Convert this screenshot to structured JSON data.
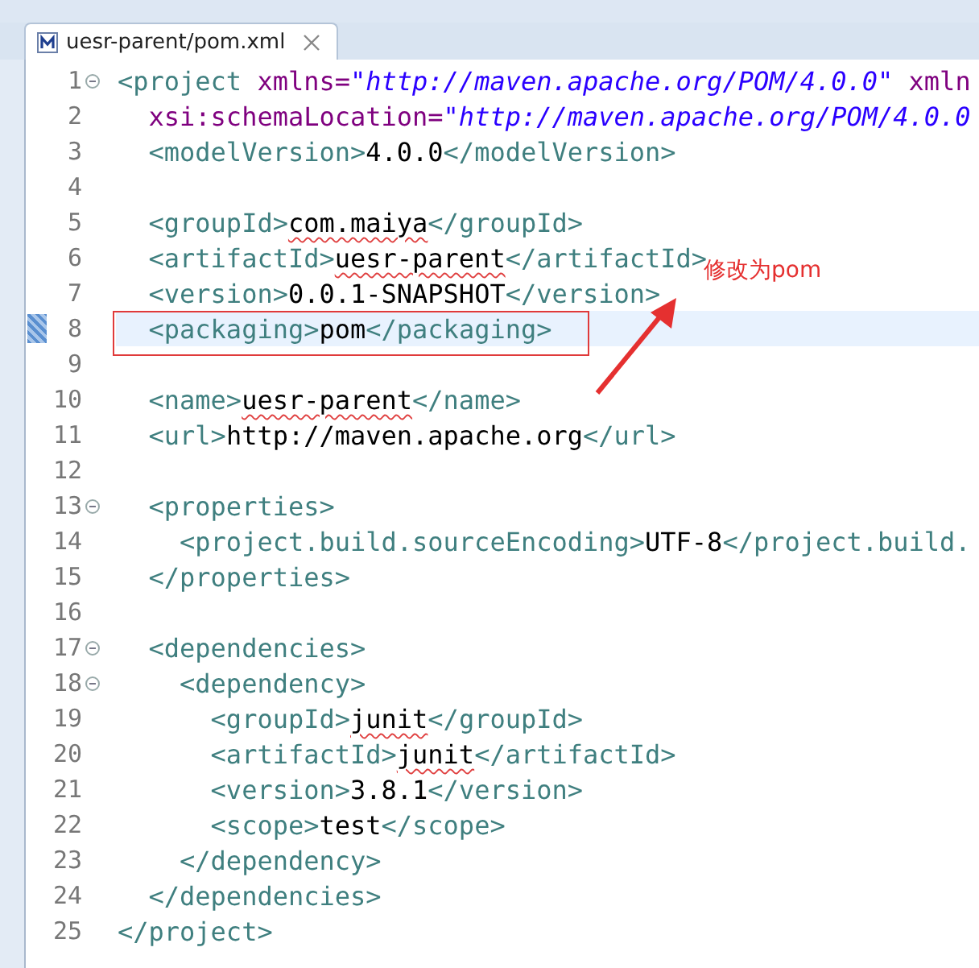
{
  "tab": {
    "title": "uesr-parent/pom.xml",
    "selected": true
  },
  "lines": [
    {
      "number": "1",
      "fold": true,
      "current": false,
      "segments": [
        {
          "kind": "tag",
          "text": "<project"
        },
        {
          "kind": "attr",
          "text": " xmlns="
        },
        {
          "kind": "value",
          "text": "\"http://maven.apache.org/POM/4.0.0\""
        },
        {
          "kind": "attr",
          "text": " xmln"
        }
      ]
    },
    {
      "number": "2",
      "fold": false,
      "current": false,
      "segments": [
        {
          "kind": "attr",
          "text": "  xsi:schemaLocation="
        },
        {
          "kind": "value",
          "text": "\"http://maven.apache.org/POM/4.0.0"
        }
      ]
    },
    {
      "number": "3",
      "fold": false,
      "current": false,
      "segments": [
        {
          "kind": "tag",
          "text": "  <modelVersion>"
        },
        {
          "kind": "text",
          "text": "4.0.0",
          "misspelled": false
        },
        {
          "kind": "tag",
          "text": "</modelVersion>"
        }
      ]
    },
    {
      "number": "4",
      "fold": false,
      "current": false
    },
    {
      "number": "5",
      "fold": false,
      "current": false,
      "segments": [
        {
          "kind": "tag",
          "text": "  <groupId>"
        },
        {
          "kind": "text",
          "text": "com.maiya",
          "misspelled": true
        },
        {
          "kind": "tag",
          "text": "</groupId>"
        }
      ]
    },
    {
      "number": "6",
      "fold": false,
      "current": false,
      "segments": [
        {
          "kind": "tag",
          "text": "  <artifactId>"
        },
        {
          "kind": "text",
          "text": "uesr-parent",
          "misspelled": true
        },
        {
          "kind": "tag",
          "text": "</artifactId>"
        }
      ]
    },
    {
      "number": "7",
      "fold": false,
      "current": false,
      "segments": [
        {
          "kind": "tag",
          "text": "  <version>"
        },
        {
          "kind": "text",
          "text": "0.0.1-SNAPSHOT",
          "misspelled": false
        },
        {
          "kind": "tag",
          "text": "</version>"
        }
      ]
    },
    {
      "number": "8",
      "fold": false,
      "current": true,
      "segments": [
        {
          "kind": "tag",
          "text": "  <packaging>"
        },
        {
          "kind": "text",
          "text": "pom",
          "misspelled": false
        },
        {
          "kind": "tag",
          "text": "</packaging>"
        }
      ]
    },
    {
      "number": "9",
      "fold": false,
      "current": false
    },
    {
      "number": "10",
      "fold": false,
      "current": false,
      "segments": [
        {
          "kind": "tag",
          "text": "  <name>"
        },
        {
          "kind": "text",
          "text": "uesr-parent",
          "misspelled": true
        },
        {
          "kind": "tag",
          "text": "</name>"
        }
      ]
    },
    {
      "number": "11",
      "fold": false,
      "current": false,
      "segments": [
        {
          "kind": "tag",
          "text": "  <url>"
        },
        {
          "kind": "text",
          "text": "http://maven.apache.org",
          "misspelled": false
        },
        {
          "kind": "tag",
          "text": "</url>"
        }
      ]
    },
    {
      "number": "12",
      "fold": false,
      "current": false
    },
    {
      "number": "13",
      "fold": true,
      "current": false,
      "segments": [
        {
          "kind": "tag",
          "text": "  <properties>"
        }
      ]
    },
    {
      "number": "14",
      "fold": false,
      "current": false,
      "segments": [
        {
          "kind": "tag",
          "text": "    <project.build.sourceEncoding>"
        },
        {
          "kind": "text",
          "text": "UTF-8",
          "misspelled": false
        },
        {
          "kind": "tag",
          "text": "</project.build."
        }
      ]
    },
    {
      "number": "15",
      "fold": false,
      "current": false,
      "segments": [
        {
          "kind": "tag",
          "text": "  </properties>"
        }
      ]
    },
    {
      "number": "16",
      "fold": false,
      "current": false
    },
    {
      "number": "17",
      "fold": true,
      "current": false,
      "segments": [
        {
          "kind": "tag",
          "text": "  <dependencies>"
        }
      ]
    },
    {
      "number": "18",
      "fold": true,
      "current": false,
      "segments": [
        {
          "kind": "tag",
          "text": "    <dependency>"
        }
      ]
    },
    {
      "number": "19",
      "fold": false,
      "current": false,
      "segments": [
        {
          "kind": "tag",
          "text": "      <groupId>"
        },
        {
          "kind": "text",
          "text": "junit",
          "misspelled": true
        },
        {
          "kind": "tag",
          "text": "</groupId>"
        }
      ]
    },
    {
      "number": "20",
      "fold": false,
      "current": false,
      "segments": [
        {
          "kind": "tag",
          "text": "      <artifactId>"
        },
        {
          "kind": "text",
          "text": "junit",
          "misspelled": true
        },
        {
          "kind": "tag",
          "text": "</artifactId>"
        }
      ]
    },
    {
      "number": "21",
      "fold": false,
      "current": false,
      "segments": [
        {
          "kind": "tag",
          "text": "      <version>"
        },
        {
          "kind": "text",
          "text": "3.8.1",
          "misspelled": false
        },
        {
          "kind": "tag",
          "text": "</version>"
        }
      ]
    },
    {
      "number": "22",
      "fold": false,
      "current": false,
      "segments": [
        {
          "kind": "tag",
          "text": "      <scope>"
        },
        {
          "kind": "text",
          "text": "test",
          "misspelled": false
        },
        {
          "kind": "tag",
          "text": "</scope>"
        }
      ]
    },
    {
      "number": "23",
      "fold": false,
      "current": false,
      "segments": [
        {
          "kind": "tag",
          "text": "    </dependency>"
        }
      ]
    },
    {
      "number": "24",
      "fold": false,
      "current": false,
      "segments": [
        {
          "kind": "tag",
          "text": "  </dependencies>"
        }
      ]
    },
    {
      "number": "25",
      "fold": false,
      "current": false,
      "segments": [
        {
          "kind": "tag",
          "text": "</project>"
        }
      ]
    }
  ],
  "annotation": {
    "note": "修改为pom"
  }
}
